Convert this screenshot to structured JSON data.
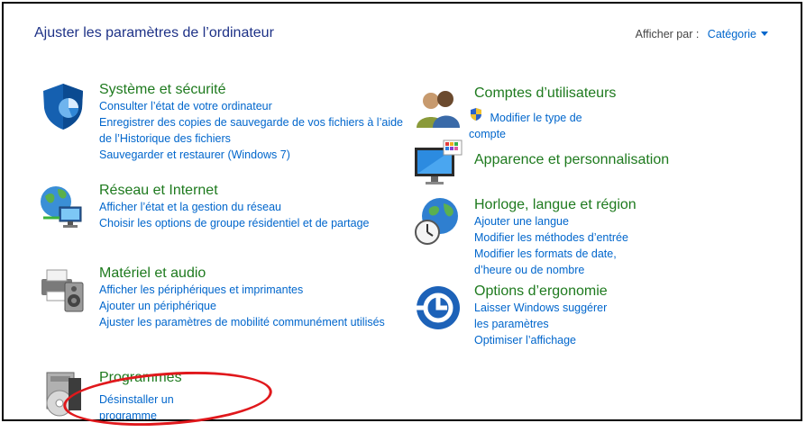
{
  "header": {
    "title": "Ajuster les paramètres de l’ordinateur",
    "view_by_label": "Afficher par :",
    "view_by_value": "Catégorie"
  },
  "left": [
    {
      "title": "Système et sécurité",
      "icon": "shield-icon",
      "links": [
        "Consulter l’état de votre ordinateur",
        "Enregistrer des copies de sauvegarde de vos fichiers à l’aide de l’Historique des fichiers",
        "Sauvegarder et restaurer (Windows 7)"
      ]
    },
    {
      "title": "Réseau et Internet",
      "icon": "network-globe-icon",
      "links": [
        "Afficher l’état et la gestion du réseau",
        "Choisir les options de groupe résidentiel et de partage"
      ]
    },
    {
      "title": "Matériel et audio",
      "icon": "printer-speaker-icon",
      "links": [
        "Afficher les périphériques et imprimantes",
        "Ajouter un périphérique",
        "Ajuster les paramètres de mobilité communément utilisés"
      ]
    },
    {
      "title": "Programmes",
      "icon": "programs-disc-icon",
      "links": [
        "Désinstaller un programme"
      ]
    }
  ],
  "right": [
    {
      "title": "Comptes d’utilisateurs",
      "icon": "users-icon",
      "links": [
        "Modifier le type de compte"
      ]
    },
    {
      "title": "Apparence et personnalisation",
      "icon": "monitor-palette-icon",
      "links": []
    },
    {
      "title": "Horloge, langue et région",
      "icon": "clock-globe-icon",
      "links": [
        "Ajouter une langue",
        "Modifier les méthodes d’entrée",
        "Modifier les formats de date, d’heure ou de nombre"
      ]
    },
    {
      "title": "Options d’ergonomie",
      "icon": "ease-of-access-icon",
      "links": [
        "Laisser Windows suggérer les paramètres",
        "Optimiser l’affichage"
      ]
    }
  ],
  "colors": {
    "title": "#1e3287",
    "category": "#1e7a1e",
    "link": "#0066cc",
    "annotation": "#e0181c"
  }
}
